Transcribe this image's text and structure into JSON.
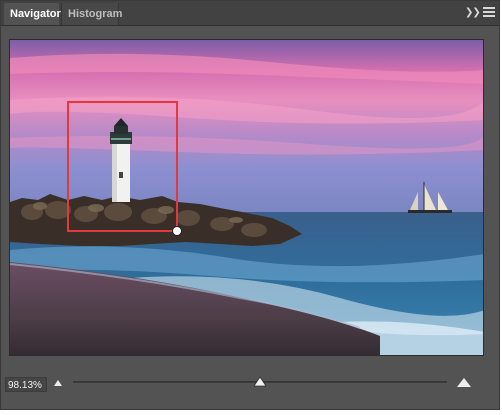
{
  "panel": {
    "tabs": [
      {
        "label": "Navigator",
        "active": true
      },
      {
        "label": "Histogram",
        "active": false
      }
    ],
    "icons": {
      "collapse": "double-chevron-right-icon",
      "menu": "panel-menu-icon"
    }
  },
  "preview": {
    "image_description": "lighthouse on rock jetty at sunset with sailboat",
    "view_box_color": "#e23a3a"
  },
  "zoom": {
    "value_text": "98.13%",
    "slider_fraction": 0.5
  },
  "colors": {
    "panel_bg": "#535353",
    "tabbar_bg": "#424242",
    "text_active": "#ffffff",
    "text_inactive": "#bdbdbd"
  }
}
